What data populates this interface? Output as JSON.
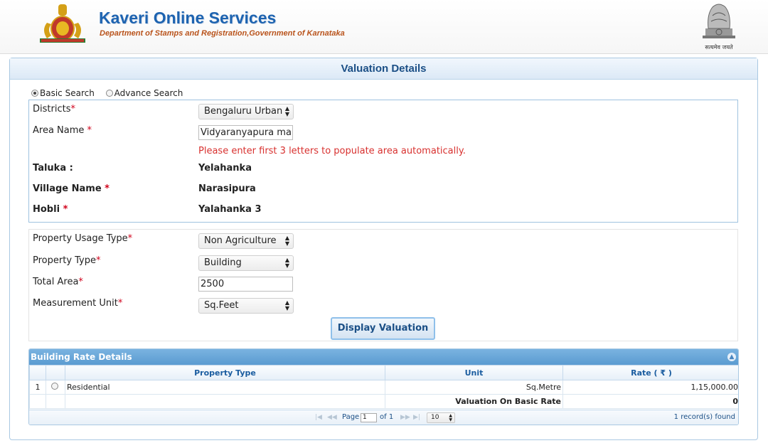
{
  "header": {
    "title": "Kaveri Online Services",
    "subtitle": "Department of Stamps and Registration,Government of Karnataka",
    "emblem_caption": "सत्यमेव जयते",
    "colors": {
      "title": "#1d63b0",
      "subtitle": "#b9531b"
    }
  },
  "panel": {
    "title": "Valuation Details"
  },
  "search_mode": {
    "basic_label": "Basic Search",
    "advance_label": "Advance Search",
    "selected": "basic"
  },
  "location": {
    "districts_label": "Districts",
    "districts_value": "Bengaluru Urban",
    "area_label": "Area Name ",
    "area_value": "Vidyaranyapura main",
    "area_hint": "Please enter first 3 letters to populate area automatically.",
    "taluka_label": "Taluka :",
    "taluka_value": "Yelahanka",
    "village_label": "Village Name ",
    "village_value": "Narasipura",
    "hobli_label": "Hobli ",
    "hobli_value": "Yalahanka 3",
    "required_mark": "*"
  },
  "property": {
    "usage_label": "Property Usage Type",
    "usage_value": "Non Agriculture",
    "type_label": "Property Type",
    "type_value": "Building",
    "area_label": "Total Area",
    "area_value": "2500",
    "unit_label": "Measurement Unit",
    "unit_value": "Sq.Feet",
    "display_button": "Display Valuation"
  },
  "grid": {
    "caption": "Building Rate Details",
    "columns": [
      "Property Type",
      "Unit",
      "Rate ( ₹ )"
    ],
    "rows": [
      {
        "num": "1",
        "property_type": "Residential",
        "unit": "Sq.Metre",
        "rate": "1,15,000.00"
      }
    ],
    "footer_label": "Valuation On Basic Rate",
    "footer_value": "0",
    "pager": {
      "page_label": "Page",
      "page_value": "1",
      "of_label": "of 1",
      "page_size": "10",
      "records": "1 record(s) found"
    }
  }
}
